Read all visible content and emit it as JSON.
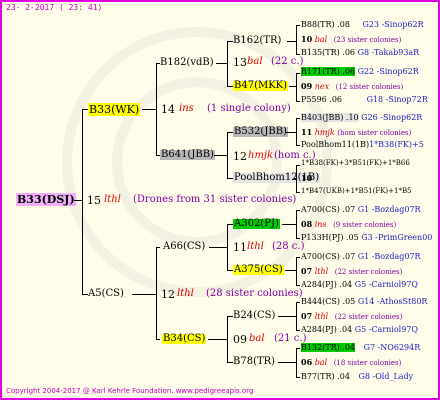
{
  "header": {
    "date": "23-  2-2017 ( 23: 41)"
  },
  "root": {
    "name": "B33(DSJ)",
    "year": "15",
    "breeder": "lthl",
    "note": "(Drones from 31 sister colonies)"
  },
  "queens": {
    "b33wk": {
      "name": "B33(WK)",
      "year": "14",
      "breeder": "ins",
      "note": "(1 single colony)"
    },
    "b182": {
      "name": "B182(vdB)"
    },
    "b162": {
      "name": "B162(TR)",
      "year": "13",
      "breeder": "bal",
      "note": "(22 c.)"
    },
    "b47": {
      "name": "B47(MKK)"
    },
    "b641": {
      "name": "B641(JBB)",
      "year": "12",
      "breeder": "hmjk",
      "note": "(hom c.)"
    },
    "b532": {
      "name": "B532(JBB)"
    },
    "poolbhom": {
      "name": "PoolBhom12(1B)"
    },
    "a5": {
      "name": "A5(CS)",
      "year": "12",
      "breeder": "lthl",
      "note": "(28 sister colonies)"
    },
    "a66": {
      "name": "A66(CS)",
      "year": "11",
      "breeder": "lthl",
      "note": "(28 c.)"
    },
    "a302": {
      "name": "A302(PJ)"
    },
    "a375": {
      "name": "A375(CS)"
    },
    "b34": {
      "name": "B34(CS)",
      "year": "09",
      "breeder": "bal",
      "note": "(21 c.)"
    },
    "b24": {
      "name": "B24(CS)"
    },
    "b78": {
      "name": "B78(TR)"
    }
  },
  "right": [
    {
      "text": "B88(TR) .08",
      "extra": "G23 -Sinop62R"
    },
    {
      "num": "10",
      "breeder": "bal",
      "note": "(23 sister colonies)"
    },
    {
      "text": "B135(TR) .06",
      "extra": "G8 -Takab93aR"
    },
    {
      "text": "B171(TR) .06",
      "extra": "G22 -Sinop62R"
    },
    {
      "num": "09",
      "breeder": "nex",
      "note": "(12 sister colonies)"
    },
    {
      "text": "P5596 .06",
      "extra": "G18 -Sinop72R"
    },
    {
      "text": "B403(JBB) .10",
      "extra": "G26 -Sinop62R"
    },
    {
      "num": "11",
      "breeder": "hmjk",
      "note": "(hom sister colonies)"
    },
    {
      "text": "PoolBhom11(1B)",
      "extra": "1*B38(FK)+5"
    },
    {
      "text": "1*B38(FK)+3*B51(FK)+1*B66"
    },
    {
      "num": "10",
      "breeder": "",
      "note": ""
    },
    {
      "text": "1*B47(UKB)+1*B51(FK)+1*B5"
    },
    {
      "text": "A700(CS) .07",
      "extra": "G1 -Bozdag07R"
    },
    {
      "num": "08",
      "breeder": "ins",
      "note": "(9 sister colonies)"
    },
    {
      "text": "P133H(PJ) .05",
      "extra": "G3 -PrimGreen00"
    },
    {
      "text": "A700(CS) .07",
      "extra": "G1 -Bozdag07R"
    },
    {
      "num": "07",
      "breeder": "lthl",
      "note": "(22 sister colonies)"
    },
    {
      "text": "A284(PJ) .04",
      "extra": "G5 -Carniol97Q"
    },
    {
      "text": "B444(CS) .05",
      "extra": "G14 -AthosSt80R"
    },
    {
      "num": "07",
      "breeder": "lthl",
      "note": "(22 sister colonies)"
    },
    {
      "text": "A284(PJ) .04",
      "extra": "G5 -Carniol97Q"
    },
    {
      "text": "B132(TR) .04",
      "extra": "G7 -NO6294R"
    },
    {
      "num": "06",
      "breeder": "bal",
      "note": "(18 sister colonies)"
    },
    {
      "text": "B77(TR) .04",
      "extra": "G8 -Old_Lady"
    }
  ],
  "footer": {
    "text": "Copyright 2004-2017 @ Karl Kehrle Foundation.   www.pedigreeapis.org"
  }
}
